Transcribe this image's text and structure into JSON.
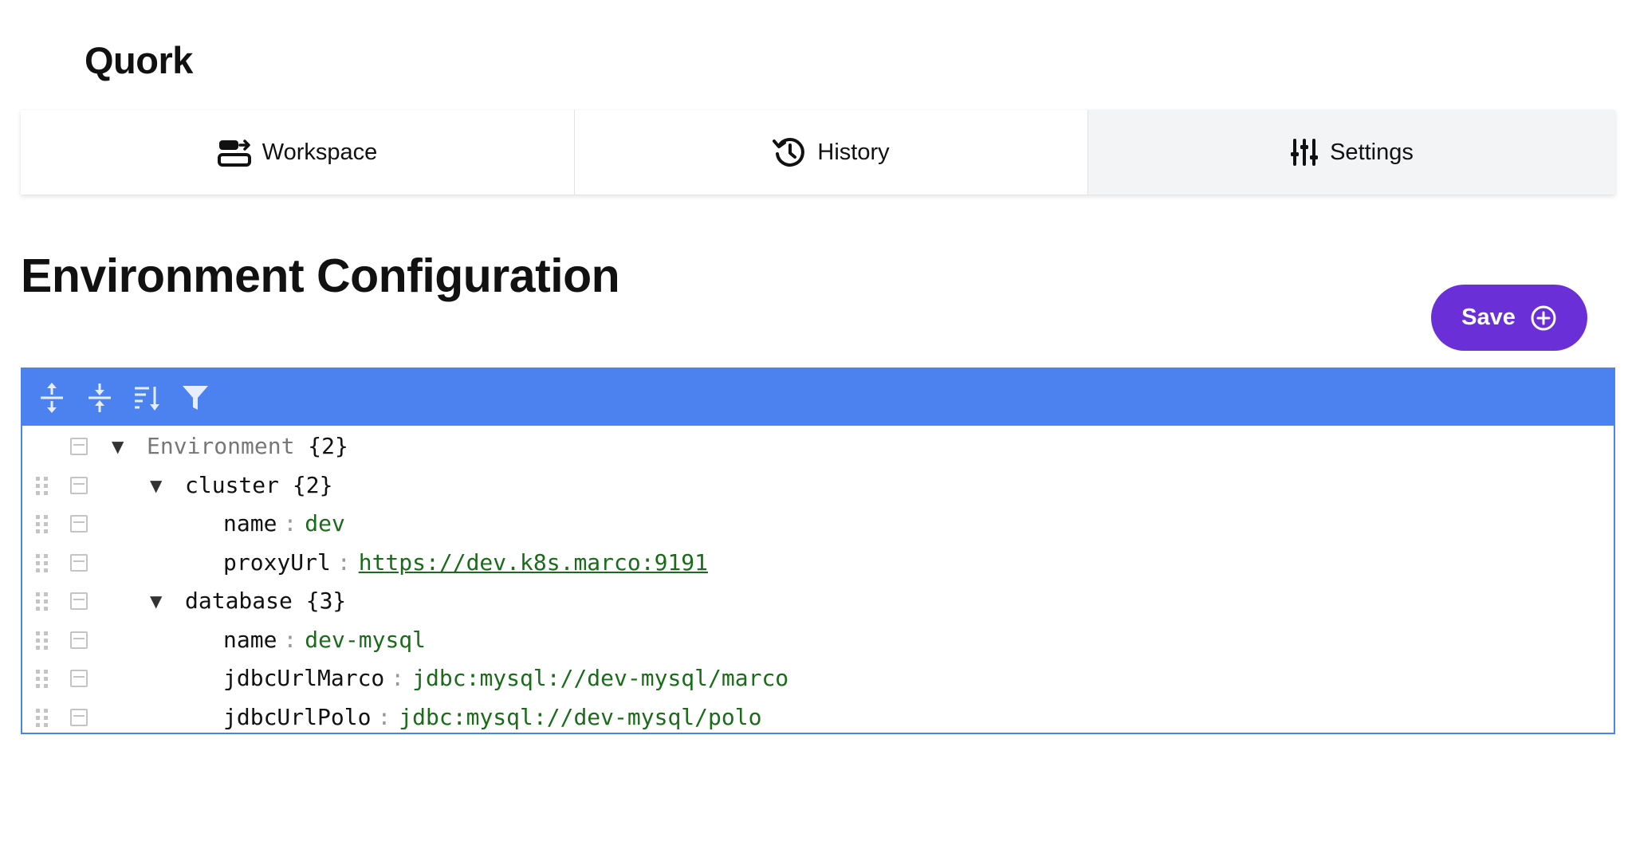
{
  "app": {
    "title": "Quork"
  },
  "tabs": [
    {
      "label": "Workspace",
      "icon": "workspace-icon"
    },
    {
      "label": "History",
      "icon": "history-icon"
    },
    {
      "label": "Settings",
      "icon": "sliders-icon",
      "active": true
    }
  ],
  "page": {
    "title": "Environment Configuration"
  },
  "save_button": {
    "label": "Save",
    "icon": "plus-circle-icon"
  },
  "editor": {
    "toolbar": [
      {
        "name": "expand-all-button",
        "icon": "expand-all-icon"
      },
      {
        "name": "collapse-all-button",
        "icon": "collapse-all-icon"
      },
      {
        "name": "sort-button",
        "icon": "sort-icon"
      },
      {
        "name": "filter-button",
        "icon": "filter-icon"
      }
    ],
    "rows": [
      {
        "field": "Environment",
        "count": "{2}",
        "expanded": true
      },
      {
        "field": "cluster",
        "count": "{2}",
        "expanded": true
      },
      {
        "field": "name",
        "colon": ":",
        "value": "dev"
      },
      {
        "field": "proxyUrl",
        "colon": ":",
        "value": "https://dev.k8s.marco:9191"
      },
      {
        "field": "database",
        "count": "{3}",
        "expanded": true
      },
      {
        "field": "name",
        "colon": ":",
        "value": "dev-mysql"
      },
      {
        "field": "jdbcUrlMarco",
        "colon": ":",
        "value": "jdbc:mysql://dev-mysql/marco"
      },
      {
        "field": "jdbcUrlPolo",
        "colon": ":",
        "value": "jdbc:mysql://dev-mysql/polo"
      }
    ]
  },
  "colors": {
    "accent": "#6a2fd6",
    "editor_header": "#4b82ef",
    "value_text": "#1a6b1a"
  }
}
